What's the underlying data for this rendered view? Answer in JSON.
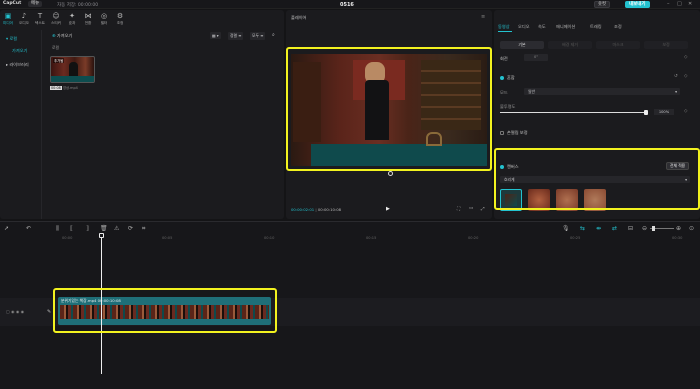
{
  "topbar": {
    "logo": "CapCut",
    "menu_label": "메뉴",
    "autosave": "자동 저장: 00:00:00",
    "title": "0516",
    "shortcut_label": "숏컷",
    "export_label": "내보내기"
  },
  "media_tabs": [
    {
      "label": "미디어",
      "icon": "media-icon",
      "active": true
    },
    {
      "label": "오디오",
      "icon": "audio-icon"
    },
    {
      "label": "텍스트",
      "icon": "text-icon"
    },
    {
      "label": "스티커",
      "icon": "sticker-icon"
    },
    {
      "label": "필터",
      "icon": "filter-icon"
    },
    {
      "label": "효과",
      "icon": "effects-icon"
    },
    {
      "label": "전환",
      "icon": "transition-icon"
    },
    {
      "label": "필터",
      "icon": "filter2-icon"
    },
    {
      "label": "조정",
      "icon": "adjust-icon"
    }
  ],
  "media_sidebar": {
    "local": "로컬",
    "import": "가져오기",
    "library": "라이브러리"
  },
  "media_panel": {
    "import_button": "가져오기",
    "section_label": "로컬",
    "toolbar": [
      "모두",
      "정렬"
    ],
    "clip": {
      "added_label": "추가됨",
      "duration": "00:08",
      "filename": "영상.mp4"
    }
  },
  "player": {
    "title": "플레이어",
    "current_time": "00:00:02:01",
    "total_time": "00:00:10:08"
  },
  "inspector": {
    "tabs": [
      {
        "label": "동영상",
        "active": true
      },
      {
        "label": "오디오"
      },
      {
        "label": "속도"
      },
      {
        "label": "애니메이션"
      },
      {
        "label": "트래킹"
      },
      {
        "label": "조정"
      }
    ],
    "subtabs": [
      {
        "label": "기본",
        "active": true
      },
      {
        "label": "배경 제거"
      },
      {
        "label": "마스크"
      },
      {
        "label": "보정"
      }
    ],
    "rotation_label": "회전",
    "blend_label": "혼합",
    "mode_label": "모드",
    "mode_value": "일반",
    "opacity_label": "불투명도",
    "opacity_value": "100%",
    "opacity_fraction": 1.0,
    "stabilize_label": "손떨림 보정",
    "canvas_label": "캔버스",
    "apply_all_label": "전체 적용",
    "canvas_select_value": "흐리게"
  },
  "timeline": {
    "ruler": [
      "00:00",
      "00:05",
      "00:10",
      "00:15",
      "00:20",
      "00:25",
      "00:30"
    ],
    "clip_label": "분위기있는 책장.mp4",
    "clip_duration": "00:00:10:08"
  },
  "colors": {
    "accent": "#23c2cf",
    "highlight": "#f2f21f",
    "background": "#141416",
    "panel": "#1b1b1e",
    "clip": "#1f6f78"
  }
}
